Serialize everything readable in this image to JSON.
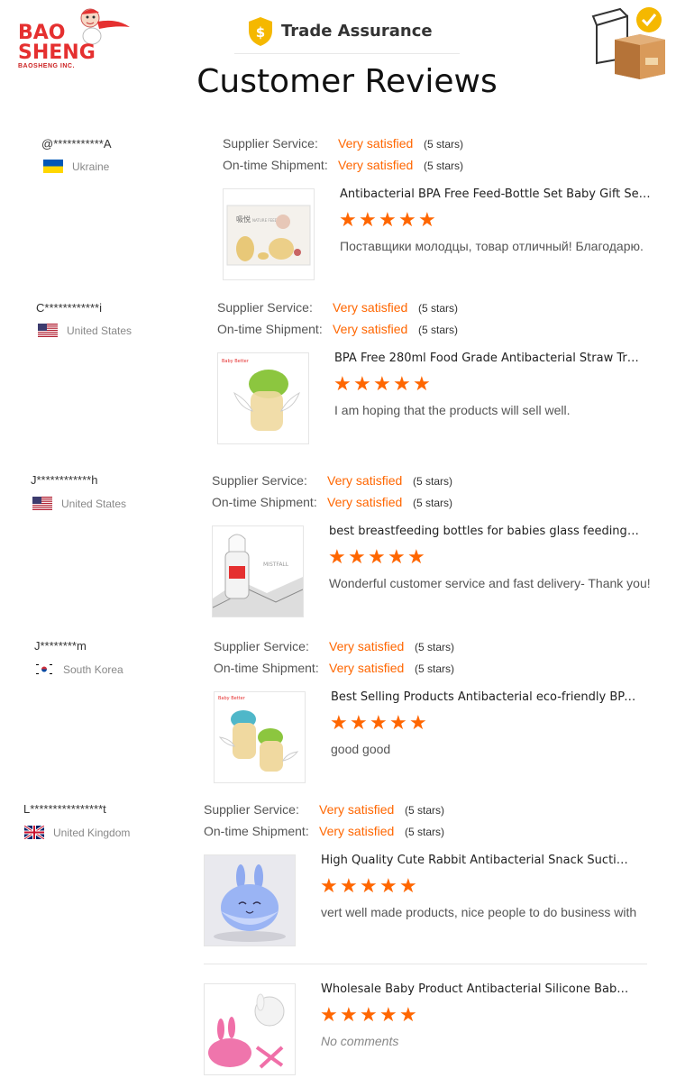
{
  "header": {
    "logo_line1": "BAO",
    "logo_line2": "SHENG",
    "logo_sub": "BAOSHENG INC.",
    "trade_assurance": "Trade Assurance",
    "title": "Customer Reviews"
  },
  "labels": {
    "supplier_service": "Supplier Service:",
    "ontime_shipment": "On-time Shipment:"
  },
  "reviews": [
    {
      "buyer": "@***********A",
      "country": "Ukraine",
      "supplier_rating": "Very satisfied",
      "supplier_stars": "(5 stars)",
      "shipment_rating": "Very satisfied",
      "shipment_stars": "(5 stars)",
      "product_title": "Antibacterial BPA Free Feed-Bottle Set Baby Gift Set B...",
      "rating": 5,
      "comment": "Поставщики молодцы, товар отличный! Благодарю."
    },
    {
      "buyer": "C************i",
      "country": "United States",
      "supplier_rating": "Very satisfied",
      "supplier_stars": "(5 stars)",
      "shipment_rating": "Very satisfied",
      "shipment_stars": "(5 stars)",
      "product_title": "BPA Free 280ml Food Grade Antibacterial Straw Train...",
      "rating": 5,
      "comment": "I am hoping that the products will sell well."
    },
    {
      "buyer": "J************h",
      "country": "United States",
      "supplier_rating": "Very satisfied",
      "supplier_stars": "(5 stars)",
      "shipment_rating": "Very satisfied",
      "shipment_stars": "(5 stars)",
      "product_title": "best breastfeeding bottles for babies glass feeding b...",
      "rating": 5,
      "comment": "Wonderful customer service and fast delivery- Thank you!"
    },
    {
      "buyer": "J********m",
      "country": "South Korea",
      "supplier_rating": "Very satisfied",
      "supplier_stars": "(5 stars)",
      "shipment_rating": "Very satisfied",
      "shipment_stars": "(5 stars)",
      "product_title": "Best Selling Products Antibacterial eco-friendly BPA F...",
      "rating": 5,
      "comment": "good good"
    },
    {
      "buyer": "L****************t",
      "country": "United Kingdom",
      "supplier_rating": "Very satisfied",
      "supplier_stars": "(5 stars)",
      "shipment_rating": "Very satisfied",
      "shipment_stars": "(5 stars)",
      "product_title": "High Quality Cute Rabbit Antibacterial Snack Suction ...",
      "rating": 5,
      "comment": "vert well made products, nice people to do business with",
      "product2_title": "Wholesale Baby Product Antibacterial Silicone Baby F...",
      "product2_rating": 5,
      "product2_comment": "No comments"
    }
  ],
  "thumb_text": {
    "brand_babysetter": "Baby Better",
    "box_cn": "吸悦",
    "box_en": "NATURE FEEDING",
    "mistfall": "MISTFALL"
  },
  "colors": {
    "accent": "#ff6600",
    "logo_red": "#e53030",
    "muted": "#888888"
  }
}
